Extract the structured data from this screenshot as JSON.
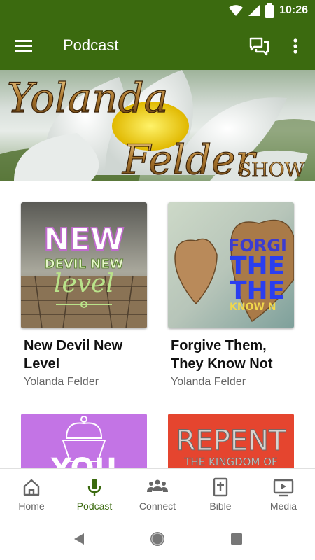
{
  "status": {
    "time": "10:26"
  },
  "appbar": {
    "title": "Podcast"
  },
  "hero": {
    "line1": "Yolanda",
    "line2": "Felder",
    "line3": "SHOW"
  },
  "podcasts": [
    {
      "title": "New Devil New Level",
      "author": "Yolanda Felder",
      "cover_text": [
        "NEW",
        "DEVIL NEW",
        "level"
      ]
    },
    {
      "title": "Forgive Them, They Know Not",
      "author": "Yolanda Felder",
      "cover_text": [
        "FORGI",
        "THE",
        "THE",
        "KNOW N"
      ]
    },
    {
      "title": "",
      "author": "",
      "cover_text": [
        "YOU"
      ]
    },
    {
      "title": "",
      "author": "",
      "cover_text": [
        "REPENT",
        "THE KINGDOM OF"
      ]
    }
  ],
  "bottom_nav": [
    {
      "label": "Home",
      "icon": "home-icon"
    },
    {
      "label": "Podcast",
      "icon": "microphone-icon",
      "active": true
    },
    {
      "label": "Connect",
      "icon": "people-icon"
    },
    {
      "label": "Bible",
      "icon": "bible-icon"
    },
    {
      "label": "Media",
      "icon": "media-icon"
    }
  ],
  "colors": {
    "primary": "#3b6a0f",
    "active_nav": "#3b6a0f",
    "inactive_nav": "#666666"
  }
}
